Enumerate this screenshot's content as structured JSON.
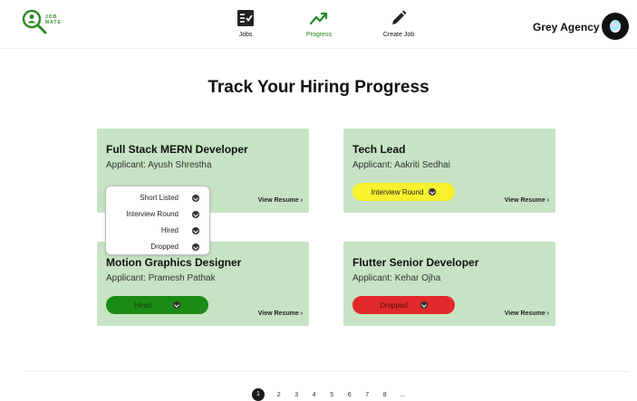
{
  "brand": {
    "logo_line1": "JOB",
    "logo_line2": "MATE",
    "color": "#2f8a2a"
  },
  "nav": {
    "items": [
      {
        "label": "Jobs",
        "icon": "checklist-icon",
        "active": false
      },
      {
        "label": "Progress",
        "icon": "trend-line-icon",
        "active": true
      },
      {
        "label": "Create Job",
        "icon": "pencil-icon",
        "active": false
      }
    ],
    "active_color": "#1d8a1d"
  },
  "account": {
    "name": "Grey Agency",
    "avatar_icon": "avatar-icon"
  },
  "page": {
    "title": "Track Your Hiring Progress"
  },
  "cards": [
    {
      "title": "Full Stack MERN Developer",
      "applicant": "Applicant: Ayush Shrestha",
      "status": "",
      "view_resume": "View Resume ›"
    },
    {
      "title": "Tech Lead",
      "applicant": "Applicant: Aakriti Sedhai",
      "status": "Interview Round",
      "status_color": "#f7f12e",
      "view_resume": "View Resume ›"
    },
    {
      "title": "Motion Graphics Designer",
      "applicant": "Applicant: Pramesh Pathak",
      "status": "Hired",
      "status_color": "#1a8b14",
      "view_resume": "View Resume ›"
    },
    {
      "title": "Flutter Senior Developer",
      "applicant": "Applicant: Kehar Ojha",
      "status": "Dropped",
      "status_color": "#e22a2a",
      "view_resume": "View Resume ›"
    }
  ],
  "card_color": "#c6e4c3",
  "status_dropdown": {
    "options": [
      "Short Listed",
      "Interview Round",
      "Hired",
      "Dropped"
    ]
  },
  "pagination": {
    "pages": [
      "1",
      "2",
      "3",
      "4",
      "5",
      "6",
      "7",
      "8",
      "..."
    ],
    "current": "1"
  }
}
